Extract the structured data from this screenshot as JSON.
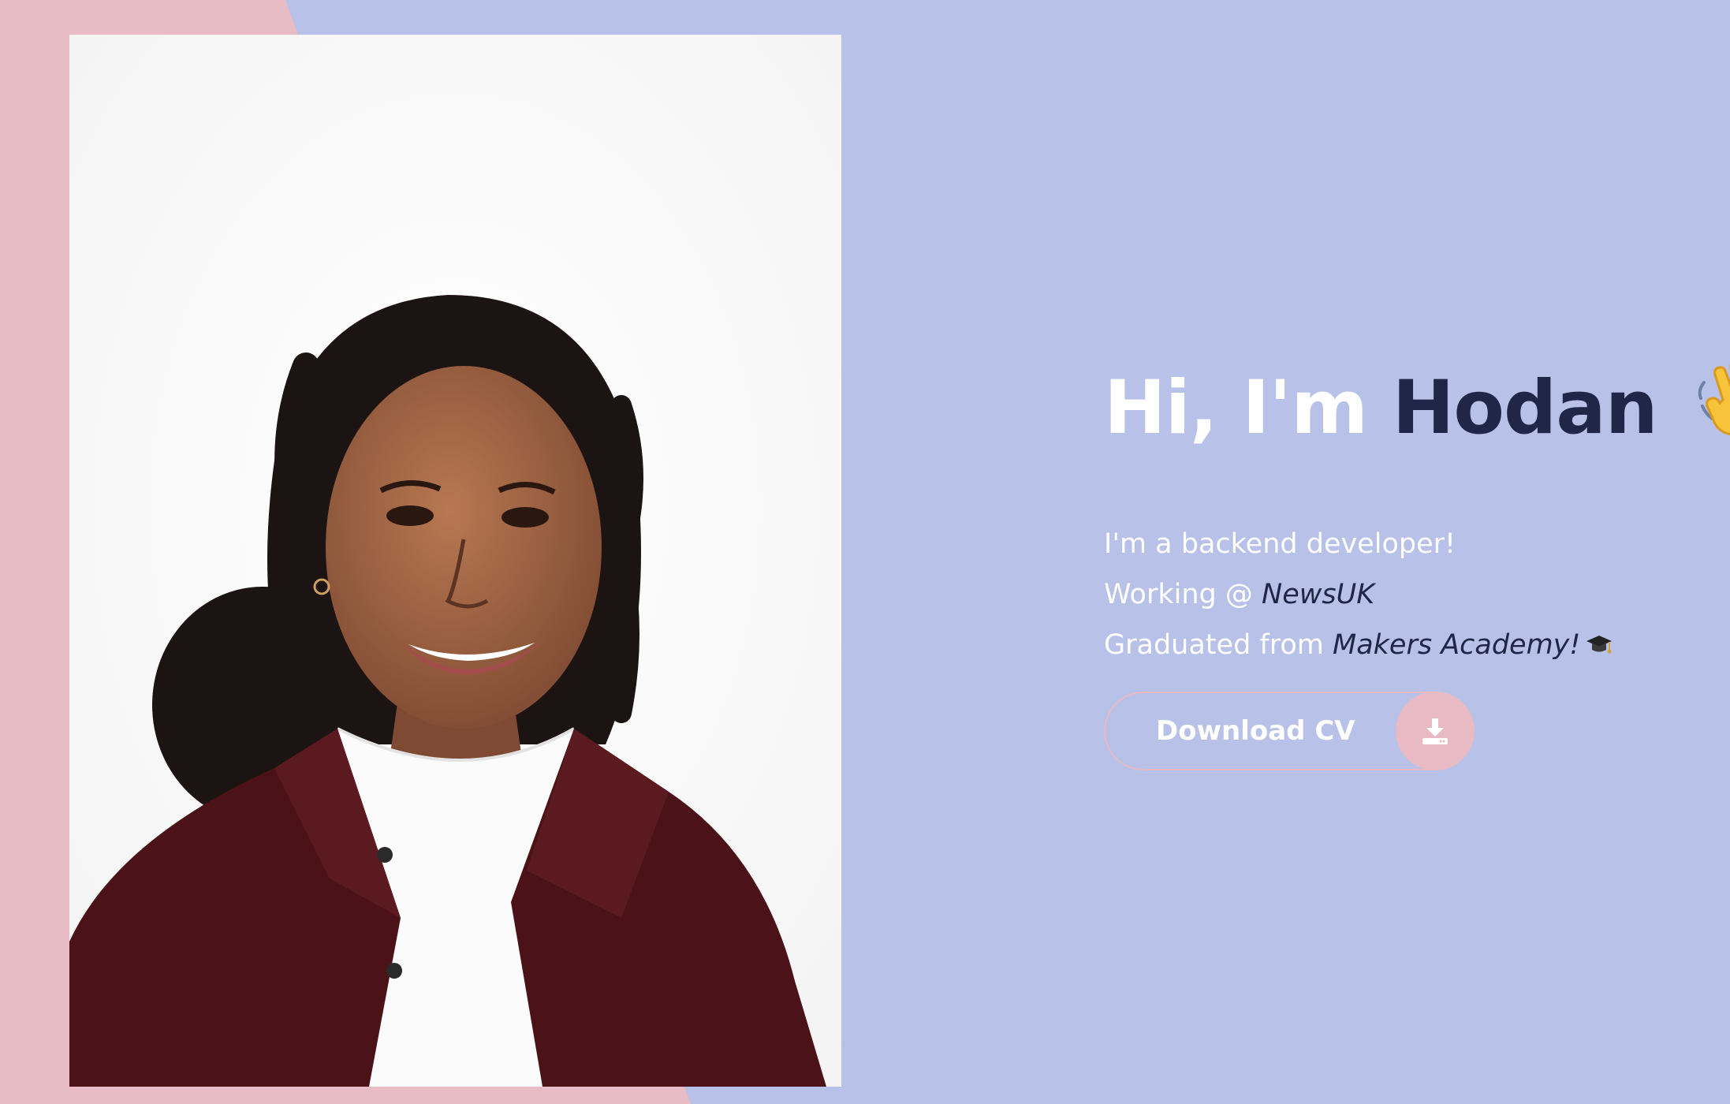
{
  "theme": {
    "background": "#b8c1e8",
    "accent_pink": "#e7bac4",
    "dark_navy": "#1f2647",
    "white": "#ffffff"
  },
  "portrait": {
    "icon": "portrait-photo"
  },
  "hero": {
    "greeting": "Hi, I'm",
    "name": "Hodan",
    "wave_icon": "waving-hand-icon",
    "bio": {
      "line1": "I'm a backend developer!",
      "line2_prefix": "Working @",
      "line2_company": "NewsUK",
      "line3_prefix": "Graduated from",
      "line3_school": "Makers Academy!",
      "cap_icon": "graduation-cap-icon"
    },
    "cv_button": {
      "label": "Download CV",
      "icon": "download-icon"
    }
  }
}
